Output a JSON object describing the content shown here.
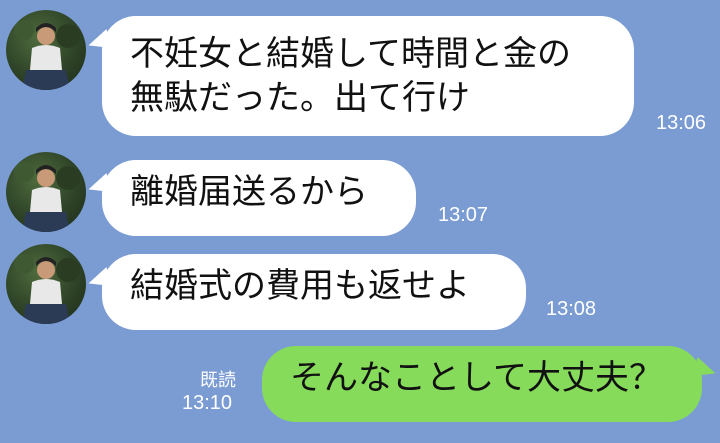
{
  "messages": [
    {
      "sender": "other",
      "lines": [
        "不妊女と結婚して時間と金の",
        "無駄だった。出て行け"
      ],
      "time": "13:06"
    },
    {
      "sender": "other",
      "lines": [
        "離婚届送るから"
      ],
      "time": "13:07"
    },
    {
      "sender": "other",
      "lines": [
        "結婚式の費用も返せよ"
      ],
      "time": "13:08"
    },
    {
      "sender": "me",
      "lines": [
        "そんなことして大丈夫？"
      ],
      "read_label": "既読",
      "time": "13:10"
    }
  ],
  "colors": {
    "background": "#7b9cd3",
    "incoming_bubble": "#ffffff",
    "outgoing_bubble": "#86dc5a",
    "timestamp": "#ffffff"
  },
  "icons": [
    "contact-avatar"
  ]
}
